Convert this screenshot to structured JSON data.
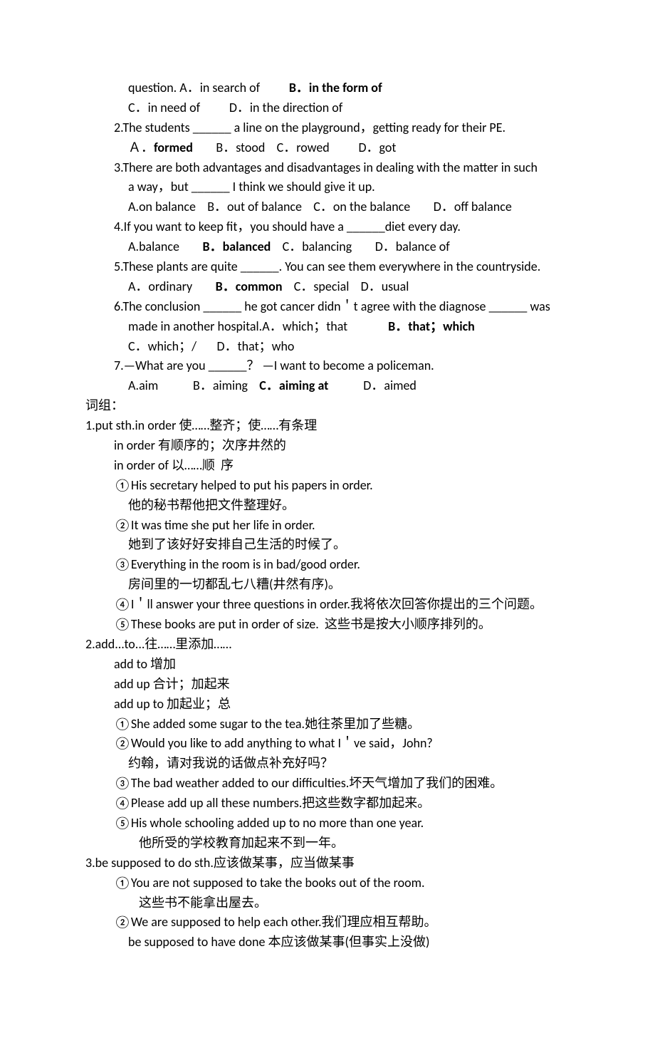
{
  "q1": {
    "line1_a": "question. A．in search of          ",
    "line1_b": "B．in the form of",
    "line2": "C．in need of          D．in the direction of"
  },
  "q2": {
    "stem": "2.The students ______ a line on the playground，getting ready for their PE.",
    "opts_a": "Ａ．",
    "opts_b": "formed",
    "opts_c": "        B．stood    C．rowed          D．got"
  },
  "q3": {
    "stem": "3.There are both advantages and disadvantages in dealing with the matter in such",
    "stem2": "a way，but ______ I think we should give it up.",
    "opts": "A.on balance    B．out of balance    C．on the balance        D．off balance"
  },
  "q4": {
    "stem": "4.If you want to keep fit，you should have a ______diet every day.",
    "opts_a": "A.balance        ",
    "opts_b": "B．balanced",
    "opts_c": "    C．balancing        D．balance of"
  },
  "q5": {
    "stem": "5.These plants are quite ______. You can see them everywhere in the countryside.",
    "opts_a": "A．ordinary        ",
    "opts_b": "B．common",
    "opts_c": "    C．special    D．usual"
  },
  "q6": {
    "stem": "6.The conclusion ______ he got cancer didn＇t agree with the diagnose ______ was",
    "stem2a": "made in another hospital.A．which；that              ",
    "stem2b": "B．that；which",
    "opts": "C．which；/       D．that；who"
  },
  "q7": {
    "stem": "7.—What are you ______？ —I want to become a policeman.",
    "opts_a": "A.aim            B．aiming    ",
    "opts_b": "C．aiming at",
    "opts_c": "            D．aimed"
  },
  "cizu": "词组：",
  "s1": {
    "h": "1.put sth.in order 使……整齐；使……有条理",
    "a": "in order 有顺序的；次序井然的",
    "b": "in order of 以……顺  序",
    "c": "①His secretary helped to put his papers in order.",
    "c2": "他的秘书帮他把文件整理好。",
    "d": "②It was time she put her life in order.",
    "d2": "她到了该好好安排自己生活的时候了。",
    "e": "③Everything in the room is in bad/good order.",
    "e2": "房间里的一切都乱七八糟(井然有序)。",
    "f": "④I＇ll answer your three questions in order.我将依次回答你提出的三个问题。",
    "g": "⑤These books are put in order of size.  这些书是按大小顺序排列的。"
  },
  "s2": {
    "h": "2.add...to...往……里添加……",
    "a": "add to 增加",
    "b": "add up 合计；加起来",
    "c": "add up to 加起业；总",
    "d": "①She added some sugar to the tea.她往茶里加了些糖。",
    "e": "②Would you like to add anything to what I＇ve said，John?",
    "e2": "约翰，请对我说的话做点补充好吗？",
    "f": "③The bad weather added to our difficulties.坏天气增加了我们的困难。",
    "g": "④Please add up all these numbers.把这些数字都加起来。",
    "i": "⑤His whole schooling added up to no more than one year.",
    "i2": "他所受的学校教育加起来不到一年。"
  },
  "s3": {
    "h": "3.be supposed to do sth.应该做某事，应当做某事",
    "a": "①You are not supposed to take the books out of the room.",
    "a2": "这些书不能拿出屋去。",
    "b": "②We are supposed to help each other.我们理应相互帮助。",
    "c": "be supposed to have done 本应该做某事(但事实上没做)"
  }
}
